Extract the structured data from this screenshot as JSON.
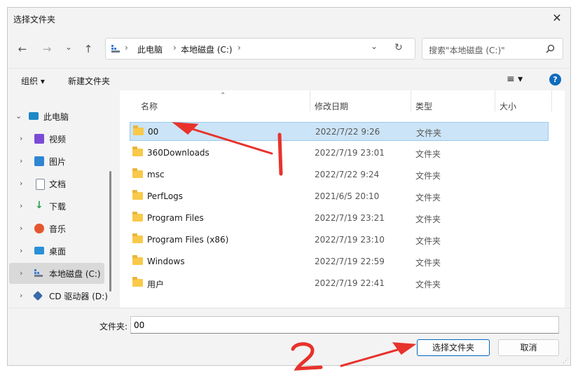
{
  "window": {
    "title": "选择文件夹",
    "close_glyph": "✕"
  },
  "nav": {
    "back": "←",
    "forward": "→",
    "recent": "⌄",
    "up": "↑",
    "refresh": "↻"
  },
  "address": {
    "crumbs": [
      "此电脑",
      "本地磁盘 (C:)"
    ],
    "separator": "›",
    "dropdown": "⌄"
  },
  "search": {
    "placeholder": "搜索\"本地磁盘 (C:)\""
  },
  "commandbar": {
    "organize": "组织 ▾",
    "new_folder": "新建文件夹",
    "view": "≡ ▾",
    "help": "?"
  },
  "sidebar": {
    "items": [
      {
        "label": "此电脑",
        "icon": "monitor-icon",
        "color": "#1e88c7",
        "expanded": true
      },
      {
        "label": "视频",
        "icon": "video-icon",
        "color": "#7b4bd6"
      },
      {
        "label": "图片",
        "icon": "picture-icon",
        "color": "#2f86d1"
      },
      {
        "label": "文档",
        "icon": "document-icon",
        "color": "#7a8a9a"
      },
      {
        "label": "下载",
        "icon": "download-icon",
        "color": "#2ca04a"
      },
      {
        "label": "音乐",
        "icon": "music-icon",
        "color": "#e4572e"
      },
      {
        "label": "桌面",
        "icon": "desktop-icon",
        "color": "#2a8fd6"
      },
      {
        "label": "本地磁盘 (C:)",
        "icon": "drive-icon",
        "color": "#3a7bd5",
        "selected": true
      },
      {
        "label": "CD 驱动器 (D:)",
        "icon": "cd-drive-icon",
        "color": "#3a6aa8"
      }
    ],
    "chevron": "›",
    "expanded_chevron": "⌄"
  },
  "columns": {
    "name": "名称",
    "date": "修改日期",
    "type": "类型",
    "size": "大小",
    "sort_glyph": "⌃"
  },
  "files": [
    {
      "name": "00",
      "date": "2022/7/22 9:26",
      "type": "文件夹",
      "selected": true
    },
    {
      "name": "360Downloads",
      "date": "2022/7/19 23:01",
      "type": "文件夹"
    },
    {
      "name": "msc",
      "date": "2022/7/22 9:24",
      "type": "文件夹"
    },
    {
      "name": "PerfLogs",
      "date": "2021/6/5 20:10",
      "type": "文件夹"
    },
    {
      "name": "Program Files",
      "date": "2022/7/19 23:21",
      "type": "文件夹"
    },
    {
      "name": "Program Files (x86)",
      "date": "2022/7/19 23:10",
      "type": "文件夹"
    },
    {
      "name": "Windows",
      "date": "2022/7/19 22:59",
      "type": "文件夹"
    },
    {
      "name": "用户",
      "date": "2022/7/19 22:41",
      "type": "文件夹"
    }
  ],
  "footer": {
    "folder_label": "文件夹:",
    "folder_value": "00",
    "select_button": "选择文件夹",
    "cancel_button": "取消"
  },
  "colors": {
    "selection": "#cce4f7",
    "accent": "#0067c0",
    "annotation": "#e8322c"
  }
}
